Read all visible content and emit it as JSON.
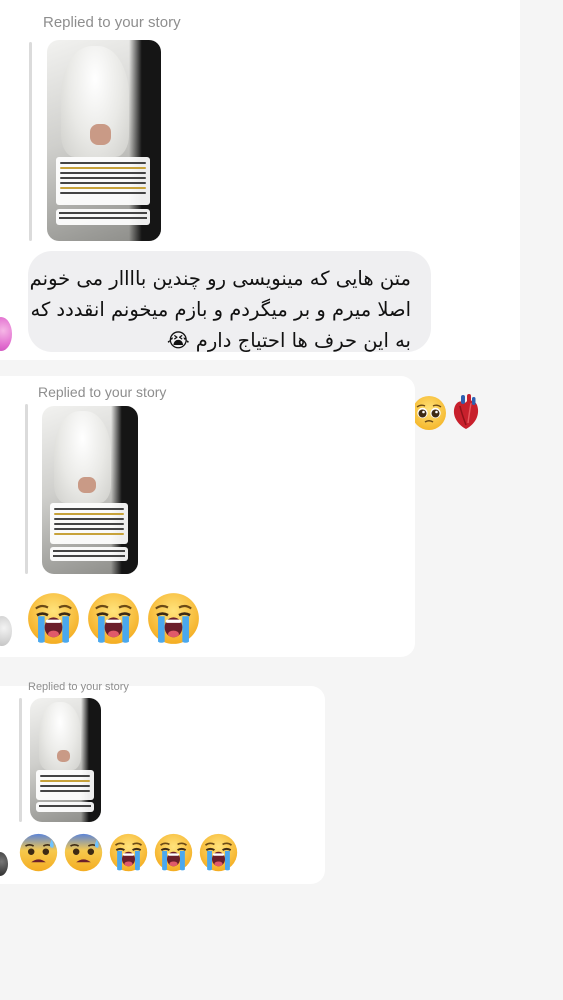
{
  "messages": [
    {
      "reply_label": "Replied to your story",
      "text_lines": [
        "متن هایی که مینویسی رو چندین باااار می خونم",
        "اصلا میرم و بر میگردم و بازم میخونم انقددد که",
        "به این حرف ها احتیاج دارم 😭"
      ],
      "reactions": [
        "pleading-face-icon",
        "anatomical-heart-icon"
      ]
    },
    {
      "reply_label": "Replied to your story",
      "emojis": [
        "loudly-crying-face-icon",
        "loudly-crying-face-icon",
        "loudly-crying-face-icon"
      ]
    },
    {
      "reply_label": "Replied to your story",
      "emojis": [
        "anxious-face-with-sweat-icon",
        "anxious-face-with-sweat-icon",
        "loudly-crying-face-icon",
        "loudly-crying-face-icon",
        "loudly-crying-face-icon"
      ]
    }
  ],
  "colors": {
    "background": "#f5f5f5",
    "panel": "#ffffff",
    "bubble": "#efeff1",
    "reply_label": "#8e8e8e"
  }
}
